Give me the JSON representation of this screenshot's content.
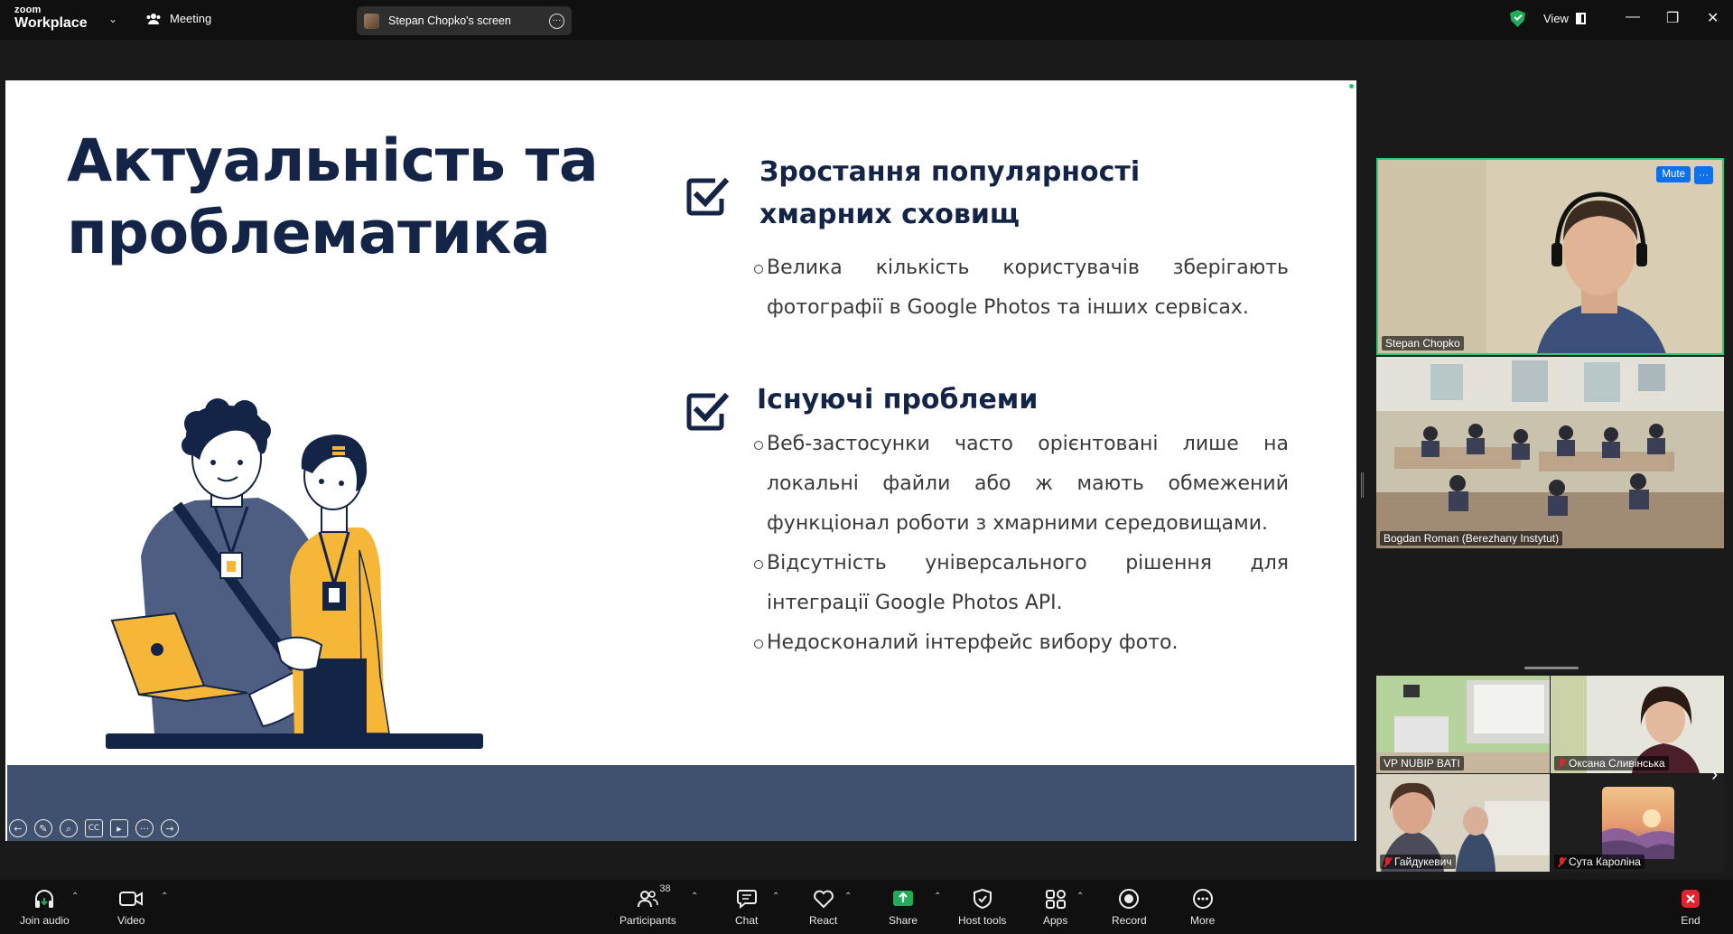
{
  "app": {
    "brand_small": "zoom",
    "brand_large": "Workplace",
    "meeting_label": "Meeting"
  },
  "screen_share": {
    "label": "Stepan Chopko's screen"
  },
  "topbar": {
    "view_label": "View"
  },
  "slide": {
    "title": [
      "Актуальність та",
      "проблематика"
    ],
    "sections": [
      {
        "heading": [
          "Зростання популярності",
          "хмарних сховищ"
        ],
        "bullets": [
          "Велика кількість користувачів зберігають фотографії в Google Photos та інших сервісах."
        ]
      },
      {
        "heading": [
          "Існуючі проблеми"
        ],
        "bullets": [
          "Веб-застосунки часто орієнтовані лише на локальні файли або ж мають обмежений функціонал роботи з хмарними середовищами.",
          "Відсутність універсального рішення для інтеграції Google Photos API.",
          "Недосконалий інтерфейс вибору фото."
        ]
      }
    ]
  },
  "participants": {
    "speaker": {
      "name": "Stepan Chopko",
      "mute_label": "Mute",
      "more_label": "···"
    },
    "room": {
      "name": "Bogdan Roman (Berezhany Instytut)"
    },
    "gallery": [
      {
        "name": "VP NUBIP BATI",
        "muted": false
      },
      {
        "name": "Оксана Сливінська",
        "muted": true
      },
      {
        "name": "Гайдукевич",
        "muted": true
      },
      {
        "name": "Сута Кароліна",
        "muted": true
      }
    ]
  },
  "controls": {
    "join_audio": "Join audio",
    "video": "Video",
    "participants": "Participants",
    "participants_count": "38",
    "chat": "Chat",
    "react": "React",
    "share": "Share",
    "host_tools": "Host tools",
    "apps": "Apps",
    "record": "Record",
    "more": "More",
    "end": "End"
  },
  "colors": {
    "share_green": "#1fae58",
    "end_red": "#e0232d",
    "accent_blue": "#0e71eb",
    "slide_navy": "#142446",
    "slide_band": "#40516f",
    "illustration_yellow": "#f6b637"
  }
}
